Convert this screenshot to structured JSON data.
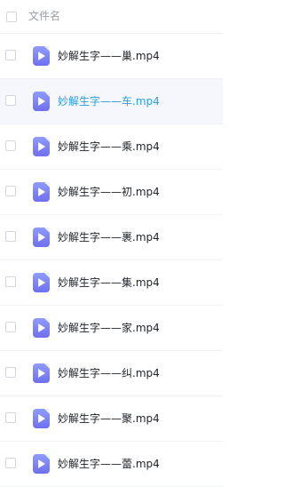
{
  "header": {
    "name_column_label": "文件名"
  },
  "files": [
    {
      "name": "妙解生字——巢.mp4",
      "active": false
    },
    {
      "name": "妙解生字——车.mp4",
      "active": true
    },
    {
      "name": "妙解生字——乘.mp4",
      "active": false
    },
    {
      "name": "妙解生字——初.mp4",
      "active": false
    },
    {
      "name": "妙解生字——裹.mp4",
      "active": false
    },
    {
      "name": "妙解生字——集.mp4",
      "active": false
    },
    {
      "name": "妙解生字——家.mp4",
      "active": false
    },
    {
      "name": "妙解生字——纠.mp4",
      "active": false
    },
    {
      "name": "妙解生字——聚.mp4",
      "active": false
    },
    {
      "name": "妙解生字——蕾.mp4",
      "active": false
    }
  ],
  "colors": {
    "icon_gradient_top": "#8f9cff",
    "icon_gradient_bottom": "#6f6ff0",
    "active_text": "#2b9fd8",
    "active_row_bg": "#f5f7fd"
  },
  "icons": {
    "file_type": "video-file-icon"
  }
}
